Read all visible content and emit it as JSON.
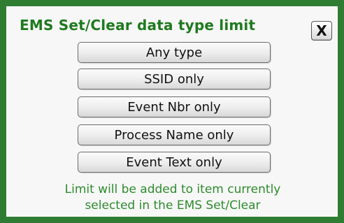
{
  "dialog": {
    "title": "EMS Set/Clear data type limit",
    "close_label": "X"
  },
  "buttons": [
    {
      "label": "Any type"
    },
    {
      "label": "SSID only"
    },
    {
      "label": "Event Nbr only"
    },
    {
      "label": "Process Name only"
    },
    {
      "label": "Event Text only"
    }
  ],
  "footer": {
    "line1": "Limit will be added to item currently",
    "line2": "selected in the EMS Set/Clear"
  },
  "colors": {
    "border": "#2e7d32",
    "title": "#1f7a1f",
    "footer_text": "#2e8b2e"
  }
}
